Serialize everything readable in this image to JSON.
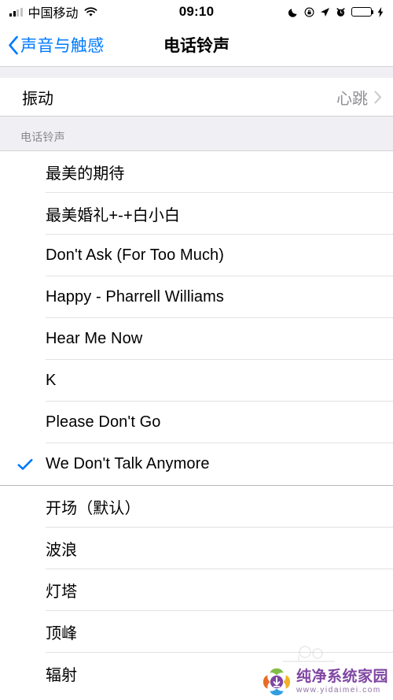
{
  "status_bar": {
    "carrier": "中国移动",
    "time": "09:10",
    "icons": {
      "signal": "signal-bars-icon",
      "wifi": "wifi-icon",
      "dnd": "moon-do-not-disturb-icon",
      "rotation_lock": "rotation-lock-icon",
      "location": "location-arrow-icon",
      "alarm": "alarm-clock-icon",
      "battery": "battery-icon",
      "charging": "lightning-bolt-icon"
    }
  },
  "nav": {
    "back_label": "声音与触感",
    "title": "电话铃声"
  },
  "vibration_row": {
    "label": "振动",
    "value": "心跳"
  },
  "section": {
    "header": "电话铃声"
  },
  "custom_ringtones": [
    {
      "label": "最美的期待",
      "selected": false
    },
    {
      "label": "最美婚礼+-+白小白",
      "selected": false
    },
    {
      "label": "Don't Ask (For Too Much)",
      "selected": false
    },
    {
      "label": "Happy - Pharrell Williams",
      "selected": false
    },
    {
      "label": "Hear Me Now",
      "selected": false
    },
    {
      "label": "K",
      "selected": false
    },
    {
      "label": "Please Don't Go",
      "selected": false
    },
    {
      "label": "We Don't Talk Anymore",
      "selected": true
    }
  ],
  "system_ringtones": [
    {
      "label": "开场（默认）",
      "selected": false
    },
    {
      "label": "波浪",
      "selected": false
    },
    {
      "label": "灯塔",
      "selected": false
    },
    {
      "label": "顶峰",
      "selected": false
    },
    {
      "label": "辐射",
      "selected": false
    }
  ],
  "watermark": {
    "title": "纯净系统家园",
    "url": "www.yidaimei.com"
  },
  "colors": {
    "accent": "#007AFF",
    "group_bg": "#EFEFF4",
    "separator": "#e2e2e4",
    "secondary_text": "#8E8E93",
    "battery_green": "#4CD964",
    "watermark_purple": "#7B3FA0"
  }
}
